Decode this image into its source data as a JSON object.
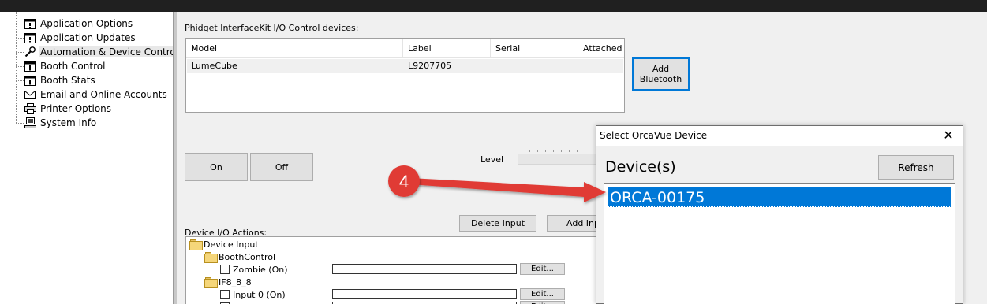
{
  "tree": {
    "items": [
      {
        "label": "Application Options",
        "icon": "options-icon"
      },
      {
        "label": "Application Updates",
        "icon": "options-icon"
      },
      {
        "label": "Automation & Device Control",
        "icon": "wrench-icon"
      },
      {
        "label": "Booth Control",
        "icon": "options-icon"
      },
      {
        "label": "Booth Stats",
        "icon": "options-icon"
      },
      {
        "label": "Email and Online Accounts",
        "icon": "envelope-icon"
      },
      {
        "label": "Printer Options",
        "icon": "printer-icon"
      },
      {
        "label": "System Info",
        "icon": "computer-icon"
      }
    ],
    "selected_index": 2
  },
  "devices": {
    "title": "Phidget InterfaceKit I/O Control devices:",
    "columns": [
      "Model",
      "Label",
      "Serial",
      "Attached"
    ],
    "rows": [
      {
        "model": "LumeCube",
        "label": "L9207705",
        "serial": "",
        "attached": ""
      }
    ],
    "add_bluetooth": "Add\nBluetooth"
  },
  "controls": {
    "on": "On",
    "off": "Off",
    "level": "Level",
    "delete_input": "Delete Input",
    "add_input": "Add Inp"
  },
  "actions": {
    "title": "Device I/O Actions:",
    "nodes": [
      {
        "label": "Device Input",
        "type": "folder"
      },
      {
        "label": "BoothControl",
        "type": "folder"
      },
      {
        "label": "Zombie (On)",
        "type": "checkbox"
      },
      {
        "label": "IF8_8_8",
        "type": "folder"
      },
      {
        "label": "Input 0 (On)",
        "type": "checkbox"
      }
    ],
    "edit_label": "Edit..."
  },
  "dialog": {
    "title": "Select OrcaVue Device",
    "devices_label": "Device(s)",
    "refresh": "Refresh",
    "items": [
      "ORCA-00175"
    ],
    "close_glyph": "✕"
  },
  "annotation": {
    "number": "4",
    "color": "#e03b35"
  },
  "colors": {
    "selection": "#0078d7",
    "topbar": "#202020",
    "panel": "#f0f0f0"
  }
}
